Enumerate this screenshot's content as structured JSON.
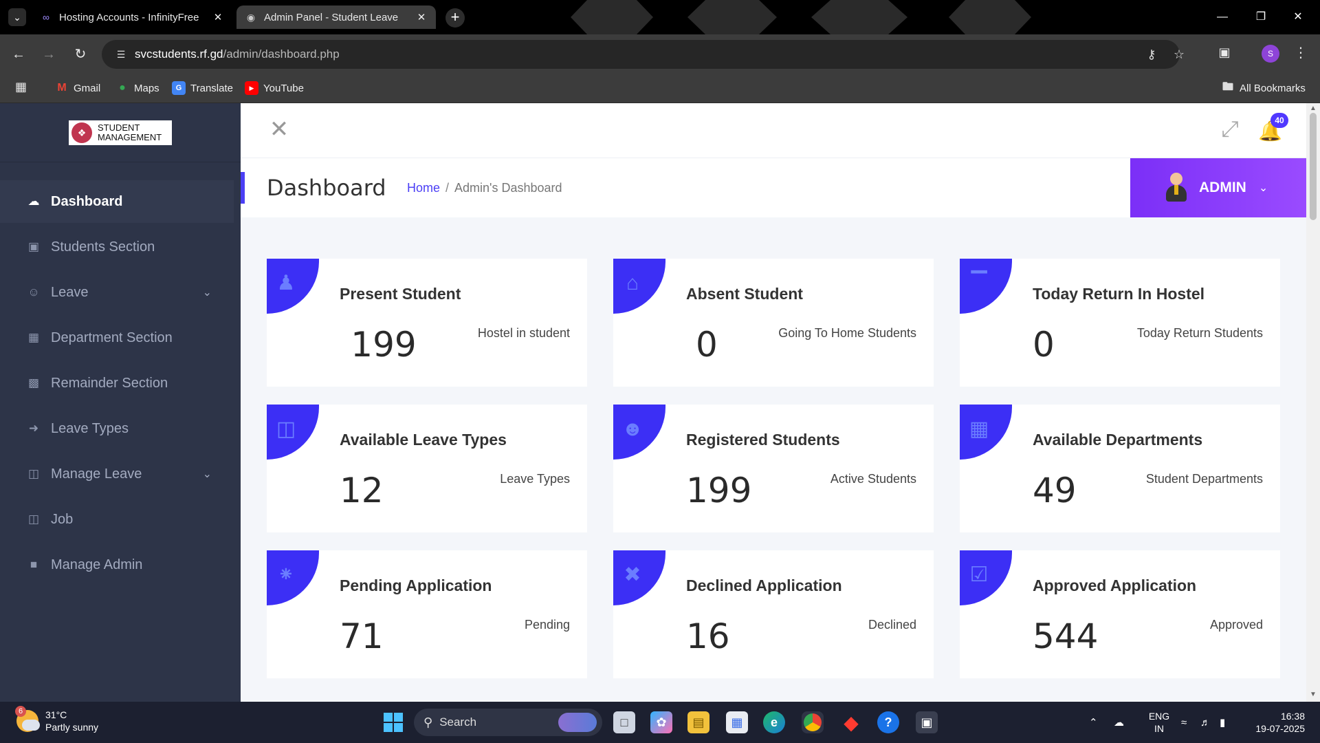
{
  "browser": {
    "tabs": [
      {
        "title": "Hosting Accounts - InfinityFree",
        "active": false
      },
      {
        "title": "Admin Panel - Student Leave",
        "active": true
      }
    ],
    "url_host": "svcstudents.rf.gd",
    "url_path": "/admin/dashboard.php",
    "bookmarks": [
      "Gmail",
      "Maps",
      "Translate",
      "YouTube"
    ],
    "all_bookmarks": "All Bookmarks",
    "profile_initial": "S"
  },
  "sidebar": {
    "logo_line1": "STUDENT",
    "logo_line2": "MANAGEMENT",
    "items": [
      {
        "label": "Dashboard",
        "icon": "dashboard-icon",
        "active": true
      },
      {
        "label": "Students Section",
        "icon": "id-card-icon"
      },
      {
        "label": "Leave",
        "icon": "user-icon",
        "has_submenu": true
      },
      {
        "label": "Department Section",
        "icon": "grid-icon"
      },
      {
        "label": "Remainder Section",
        "icon": "calendar-icon"
      },
      {
        "label": "Leave Types",
        "icon": "sign-out-icon"
      },
      {
        "label": "Manage Leave",
        "icon": "briefcase-icon",
        "has_submenu": true
      },
      {
        "label": "Job",
        "icon": "briefcase-icon"
      },
      {
        "label": "Manage Admin",
        "icon": "lock-icon"
      }
    ]
  },
  "header": {
    "notification_count": "40",
    "page_title": "Dashboard",
    "breadcrumb_home": "Home",
    "breadcrumb_sep": "/",
    "breadcrumb_current": "Admin's Dashboard",
    "admin_label": "ADMIN"
  },
  "cards": [
    {
      "title": "Present Student",
      "value": "199",
      "subtitle": "Hostel in student",
      "icon": "child-icon"
    },
    {
      "title": "Absent Student",
      "value": "0",
      "subtitle": "Going To Home Students",
      "icon": "home-icon"
    },
    {
      "title": "Today Return In Hostel",
      "value": "0",
      "subtitle": "Today Return Students",
      "icon": "bed-icon"
    },
    {
      "title": "Available Leave Types",
      "value": "12",
      "subtitle": "Leave Types",
      "icon": "briefcase-icon"
    },
    {
      "title": "Registered Students",
      "value": "199",
      "subtitle": "Active Students",
      "icon": "users-icon"
    },
    {
      "title": "Available Departments",
      "value": "49",
      "subtitle": "Student Departments",
      "icon": "grid-icon"
    },
    {
      "title": "Pending Application",
      "value": "71",
      "subtitle": "Pending",
      "icon": "spinner-icon"
    },
    {
      "title": "Declined Application",
      "value": "16",
      "subtitle": "Declined",
      "icon": "times-icon"
    },
    {
      "title": "Approved Application",
      "value": "544",
      "subtitle": "Approved",
      "icon": "check-square-icon"
    }
  ],
  "taskbar": {
    "weather_temp": "31°C",
    "weather_desc": "Partly sunny",
    "weather_badge": "6",
    "search_placeholder": "Search",
    "lang_line1": "ENG",
    "lang_line2": "IN",
    "time": "16:38",
    "date": "19-07-2025"
  },
  "colors": {
    "accent": "#3c2ff5",
    "sidebar_bg": "#2d3448",
    "admin_gradient_start": "#7b2ff7",
    "admin_gradient_end": "#9a4bff"
  }
}
